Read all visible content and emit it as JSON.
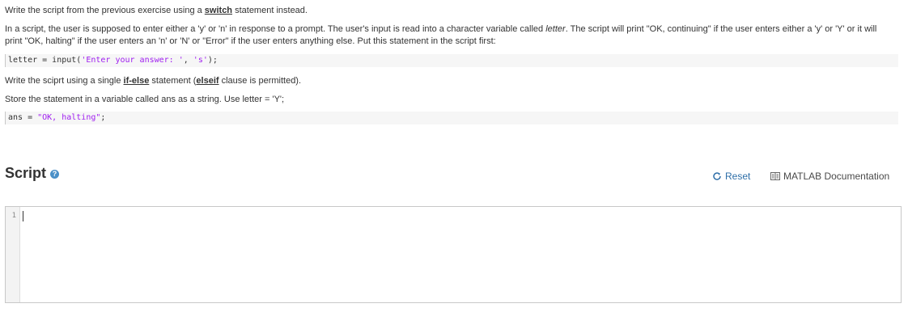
{
  "problem": {
    "p1": {
      "before": "Write the script from the previous exercise using a ",
      "keyword": "switch",
      "after": " statement instead."
    },
    "p2": {
      "before": "In a script, the user is supposed to enter either a 'y' or 'n' in response to a prompt. The user's input is read into a character variable called ",
      "var": "letter",
      "after": ". The script will print \"OK, continuing\" if the user enters either a 'y' or 'Y' or it will print \"OK, halting\" if the user enters an 'n' or 'N' or \"Error\" if the user enters anything else. Put this statement in the script first:"
    },
    "code1": {
      "prefix": "letter = input(",
      "str1": "'Enter your answer: '",
      "mid": ", ",
      "str2": "'s'",
      "suffix": ");"
    },
    "p3": {
      "before": "Write the sciprt using a single ",
      "keyword1": "if-else",
      "middle": " statement (",
      "keyword2": "elseif",
      "after": " clause is permitted)."
    },
    "p4": {
      "text": "Store the statement in a variable called ans as a string. Use letter = 'Y';"
    },
    "code2": {
      "prefix": "ans = ",
      "str": "\"OK, halting\"",
      "suffix": ";"
    }
  },
  "script": {
    "title": "Script",
    "help_icon": "question-circle-icon",
    "reset_label": "Reset",
    "reset_icon": "refresh-icon",
    "docs_label": "MATLAB Documentation",
    "docs_icon": "book-icon"
  },
  "editor": {
    "line_numbers": [
      "1"
    ],
    "content": ""
  },
  "colors": {
    "link_blue": "#2f6fa8",
    "string_purple": "#a020f0",
    "help_blue": "#4a90c8"
  }
}
